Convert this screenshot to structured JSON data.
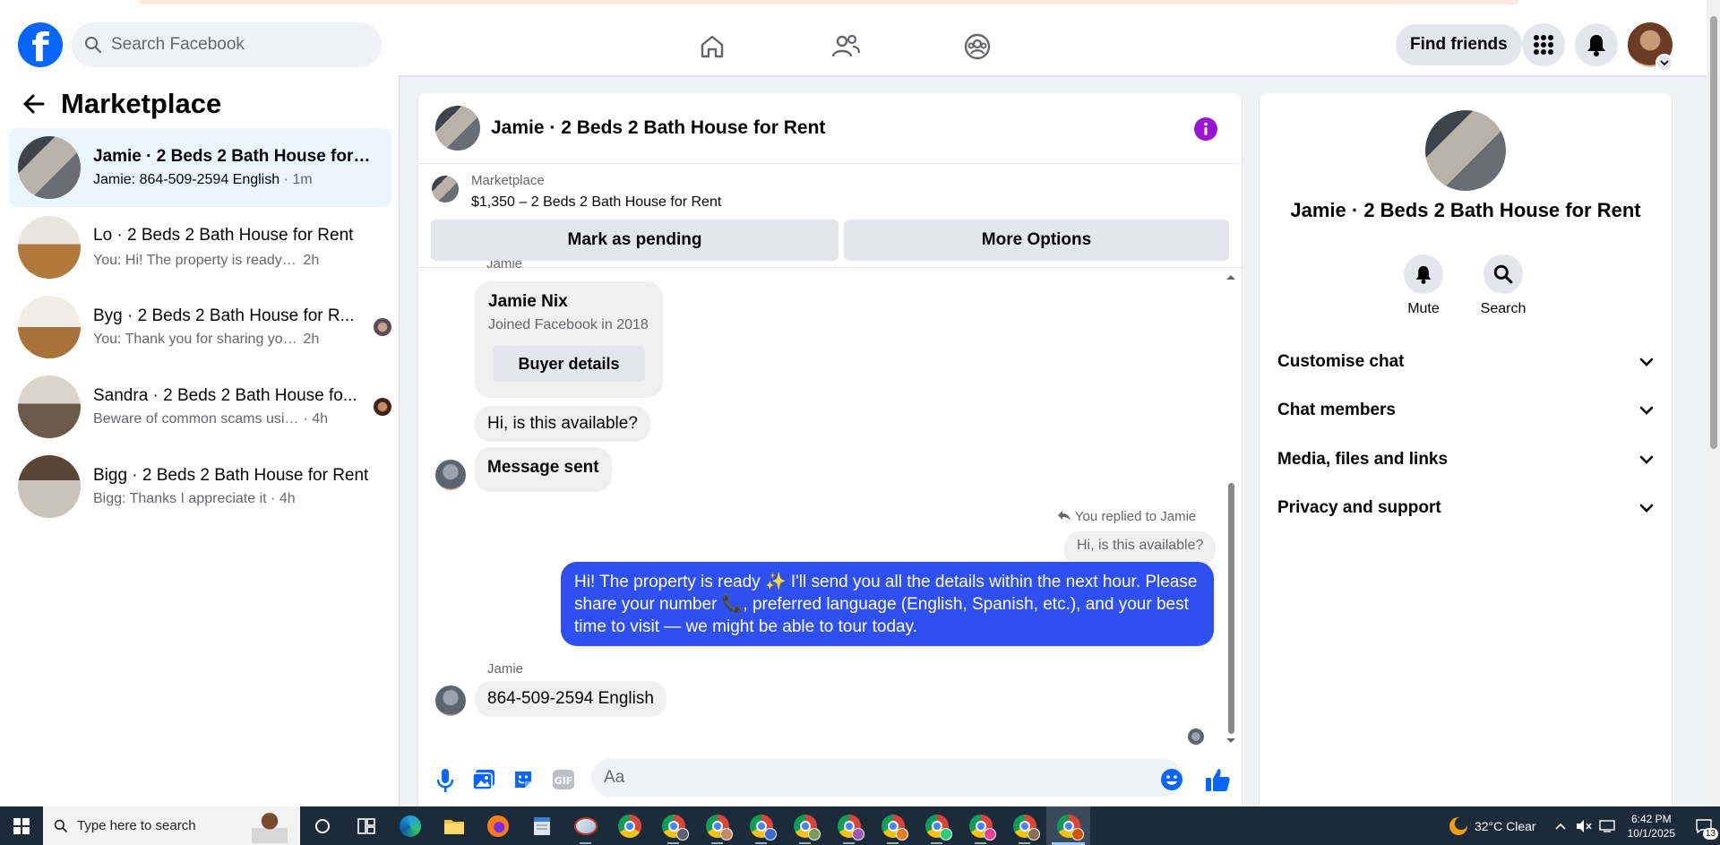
{
  "topbar": {
    "search_placeholder": "Search Facebook",
    "find_friends": "Find friends"
  },
  "sidebar": {
    "title": "Marketplace",
    "conversations": [
      {
        "title": "Jamie · 2 Beds 2 Bath House for Re...",
        "snippet": "Jamie: 864-509-2594 English",
        "time": "· 1m",
        "active": true
      },
      {
        "title": "Lo · 2 Beds 2 Bath House for Rent",
        "snippet": "You: Hi! The property is ready ✨ I'll s...",
        "time": "2h"
      },
      {
        "title": "Byg · 2 Beds 2 Bath House for R...",
        "snippet": "You: Thank you for sharing your nu...",
        "time": "2h"
      },
      {
        "title": "Sandra · 2 Beds 2 Bath House fo...",
        "snippet": "Beware of common scams using p...",
        "time": "· 4h"
      },
      {
        "title": "Bigg · 2 Beds 2 Bath House for Rent",
        "snippet": "Bigg: Thanks I appreciate it",
        "time": "· 4h"
      }
    ]
  },
  "chat": {
    "title": "Jamie · 2 Beds 2 Bath House for Rent",
    "marketplace_label": "Marketplace",
    "listing": "$1,350 – 2 Beds 2 Bath House for Rent",
    "mark_pending": "Mark as pending",
    "more_options": "More Options",
    "sender_cut": "Jamie",
    "buyer_name": "Jamie Nix",
    "buyer_joined": "Joined Facebook in 2018",
    "buyer_details": "Buyer details",
    "msg_available": "Hi, is this available?",
    "msg_sent": "Message sent",
    "replied_to": "You replied to Jamie",
    "quoted": "Hi, is this available?",
    "outgoing": "Hi! The property is ready ✨ I'll send you all the details within the next hour. Please share your number 📞, preferred language (English, Spanish, etc.), and your best time to visit — we might be able to tour today.",
    "sender": "Jamie",
    "incoming": "864-509-2594 English",
    "composer_placeholder": "Aa"
  },
  "right_panel": {
    "name": "Jamie · 2 Beds 2 Bath House for Rent",
    "mute": "Mute",
    "search": "Search",
    "sections": [
      "Customise chat",
      "Chat members",
      "Media, files and links",
      "Privacy and support"
    ]
  },
  "taskbar": {
    "search": "Type here to search",
    "weather": "32°C  Clear",
    "time": "6:42 PM",
    "date": "10/1/2025",
    "notifications": "13"
  },
  "colors": {
    "brand": "#0866ff",
    "outgoing_bubble": "#2f50f0",
    "info": "#9b15d6"
  }
}
